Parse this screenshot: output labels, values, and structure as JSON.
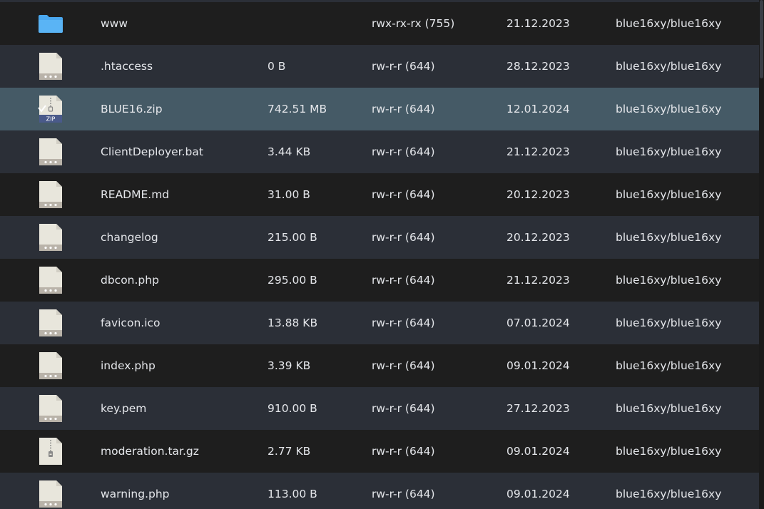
{
  "files": [
    {
      "name": "www",
      "size": "",
      "permissions": "rwx-rx-rx (755)",
      "date": "21.12.2023",
      "owner": "blue16xy/blue16xy",
      "icon": "folder-icon"
    },
    {
      "name": ".htaccess",
      "size": "0 B",
      "permissions": "rw-r-r (644)",
      "date": "28.12.2023",
      "owner": "blue16xy/blue16xy",
      "icon": "file-icon"
    },
    {
      "name": "BLUE16.zip",
      "size": "742.51 MB",
      "permissions": "rw-r-r (644)",
      "date": "12.01.2024",
      "owner": "blue16xy/blue16xy",
      "icon": "zip-file-icon",
      "icon_label": "ZIP"
    },
    {
      "name": "ClientDeployer.bat",
      "size": "3.44 KB",
      "permissions": "rw-r-r (644)",
      "date": "21.12.2023",
      "owner": "blue16xy/blue16xy",
      "icon": "file-icon"
    },
    {
      "name": "README.md",
      "size": "31.00 B",
      "permissions": "rw-r-r (644)",
      "date": "20.12.2023",
      "owner": "blue16xy/blue16xy",
      "icon": "file-icon"
    },
    {
      "name": "changelog",
      "size": "215.00 B",
      "permissions": "rw-r-r (644)",
      "date": "20.12.2023",
      "owner": "blue16xy/blue16xy",
      "icon": "file-icon"
    },
    {
      "name": "dbcon.php",
      "size": "295.00 B",
      "permissions": "rw-r-r (644)",
      "date": "21.12.2023",
      "owner": "blue16xy/blue16xy",
      "icon": "file-icon"
    },
    {
      "name": "favicon.ico",
      "size": "13.88 KB",
      "permissions": "rw-r-r (644)",
      "date": "07.01.2024",
      "owner": "blue16xy/blue16xy",
      "icon": "file-icon"
    },
    {
      "name": "index.php",
      "size": "3.39 KB",
      "permissions": "rw-r-r (644)",
      "date": "09.01.2024",
      "owner": "blue16xy/blue16xy",
      "icon": "file-icon"
    },
    {
      "name": "key.pem",
      "size": "910.00 B",
      "permissions": "rw-r-r (644)",
      "date": "27.12.2023",
      "owner": "blue16xy/blue16xy",
      "icon": "file-icon"
    },
    {
      "name": "moderation.tar.gz",
      "size": "2.77 KB",
      "permissions": "rw-r-r (644)",
      "date": "09.01.2024",
      "owner": "blue16xy/blue16xy",
      "icon": "archive-file-icon"
    },
    {
      "name": "warning.php",
      "size": "113.00 B",
      "permissions": "rw-r-r (644)",
      "date": "09.01.2024",
      "owner": "blue16xy/blue16xy",
      "icon": "file-icon"
    }
  ],
  "selected_index": 2,
  "colors": {
    "row_dark": "#1e1e1e",
    "row_light": "#2b2f37",
    "row_selected": "#455a66",
    "text": "#e4e6ea",
    "folder": "#4aa8f0",
    "file_icon": "#e8e6dc",
    "file_icon_band": "#b9b3a9",
    "zip_band": "#4a5a8a"
  }
}
